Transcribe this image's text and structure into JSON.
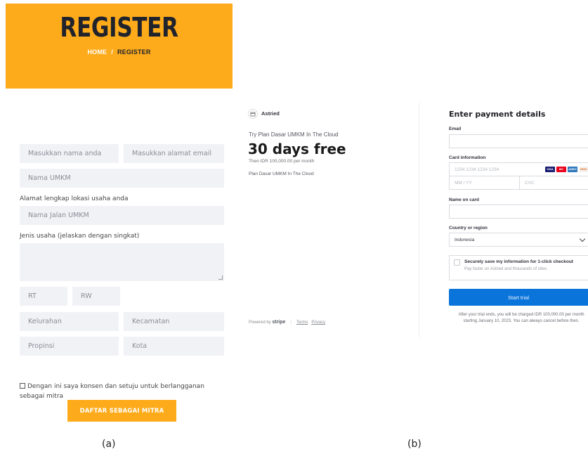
{
  "panel_a": {
    "hero": {
      "title": "REGISTER",
      "breadcrumb_home": "HOME",
      "breadcrumb_sep": "/",
      "breadcrumb_current": "REGISTER"
    },
    "form": {
      "name_placeholder": "Masukkan nama anda",
      "email_placeholder": "Masukkan alamat email",
      "umkm_placeholder": "Nama UMKM",
      "address_label": "Alamat lengkap lokasi usaha anda",
      "street_placeholder": "Nama Jalan UMKM",
      "business_label": "Jenis usaha (jelaskan dengan singkat)",
      "rt_placeholder": "RT",
      "rw_placeholder": "RW",
      "kelurahan_placeholder": "Kelurahan",
      "kecamatan_placeholder": "Kecamatan",
      "propinsi_placeholder": "Propinsi",
      "kota_placeholder": "Kota",
      "consent_text": "Dengan ini saya konsen dan setuju untuk berlangganan sebagai mitra",
      "submit_label": "DAFTAR SEBAGAI MITRA"
    },
    "caption": "(a)"
  },
  "panel_b": {
    "summary": {
      "merchant": "Astried",
      "try_text": "Try Plan Dasar UMKM In The Cloud",
      "price_headline": "30 days free",
      "then_text": "Then IDR 100,000.00 per month",
      "plan_line": "Plan Dasar UMKM In The Cloud",
      "powered_by": "Powered by",
      "stripe_word": "stripe",
      "terms": "Terms",
      "privacy": "Privacy"
    },
    "payment": {
      "title": "Enter payment details",
      "email_label": "Email",
      "card_label": "Card information",
      "card_placeholder": "1234 1234 1234 1234",
      "expiry_placeholder": "MM / YY",
      "cvc_placeholder": "CVC",
      "card_brands": [
        "VISA",
        "MC",
        "AMEX",
        "DISC"
      ],
      "name_label": "Name on card",
      "country_label": "Country or region",
      "country_value": "Indonesia",
      "save_title": "Securely save my information for 1-click checkout",
      "save_sub": "Pay faster on Astried and thousands of sites.",
      "start_button": "Start trial",
      "trial_note": "After your trial ends, you will be charged IDR 100,000.00 per month starting January 10, 2023. You can always cancel before then."
    },
    "caption": "(b)"
  },
  "colors": {
    "brand_orange": "#fdab1b",
    "hero_text": "#20232b",
    "field_bg": "#f1f2f6",
    "stripe_blue": "#0a74da"
  }
}
